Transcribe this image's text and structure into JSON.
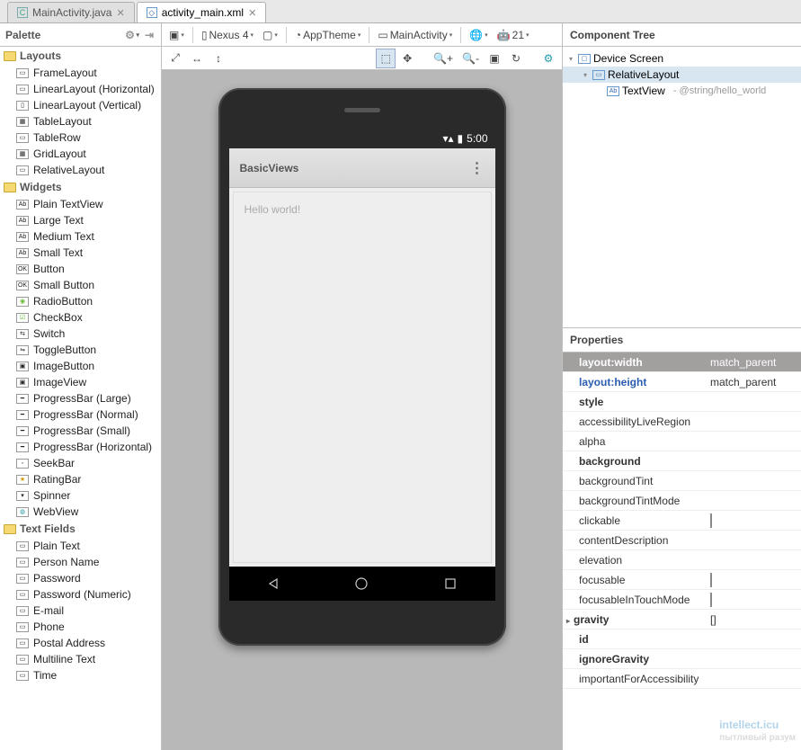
{
  "tabs": [
    {
      "label": "MainActivity.java",
      "active": false
    },
    {
      "label": "activity_main.xml",
      "active": true
    }
  ],
  "palette": {
    "title": "Palette",
    "cats": [
      {
        "name": "Layouts",
        "items": [
          "FrameLayout",
          "LinearLayout (Horizontal)",
          "LinearLayout (Vertical)",
          "TableLayout",
          "TableRow",
          "GridLayout",
          "RelativeLayout"
        ]
      },
      {
        "name": "Widgets",
        "items": [
          "Plain TextView",
          "Large Text",
          "Medium Text",
          "Small Text",
          "Button",
          "Small Button",
          "RadioButton",
          "CheckBox",
          "Switch",
          "ToggleButton",
          "ImageButton",
          "ImageView",
          "ProgressBar (Large)",
          "ProgressBar (Normal)",
          "ProgressBar (Small)",
          "ProgressBar (Horizontal)",
          "SeekBar",
          "RatingBar",
          "Spinner",
          "WebView"
        ]
      },
      {
        "name": "Text Fields",
        "items": [
          "Plain Text",
          "Person Name",
          "Password",
          "Password (Numeric)",
          "E-mail",
          "Phone",
          "Postal Address",
          "Multiline Text",
          "Time"
        ]
      }
    ]
  },
  "icons": {
    "Plain TextView": "Ab",
    "Large Text": "Ab",
    "Medium Text": "Ab",
    "Small Text": "Ab",
    "Button": "OK",
    "Small Button": "OK",
    "RadioButton": "◉",
    "CheckBox": "☑",
    "Switch": "⇆",
    "ToggleButton": "⇋",
    "ImageButton": "▣",
    "ImageView": "▣",
    "ProgressBar (Large)": "━",
    "ProgressBar (Normal)": "━",
    "ProgressBar (Small)": "━",
    "ProgressBar (Horizontal)": "━",
    "SeekBar": "◦",
    "RatingBar": "★",
    "Spinner": "▾",
    "WebView": "◍",
    "FrameLayout": "▭",
    "LinearLayout (Horizontal)": "▭",
    "LinearLayout (Vertical)": "▯",
    "TableLayout": "▦",
    "TableRow": "▭",
    "GridLayout": "▦",
    "RelativeLayout": "▭",
    "Plain Text": "▭",
    "Person Name": "▭",
    "Password": "▭",
    "Password (Numeric)": "▭",
    "E-mail": "▭",
    "Phone": "▭",
    "Postal Address": "▭",
    "Multiline Text": "▭",
    "Time": "▭"
  },
  "toolbar": {
    "device": "Nexus 4",
    "theme": "AppTheme",
    "context": "MainActivity",
    "api": "21"
  },
  "preview": {
    "status_time": "5:00",
    "app_title": "BasicViews",
    "content": "Hello world!"
  },
  "tree": {
    "title": "Component Tree",
    "nodes": [
      {
        "label": "Device Screen",
        "indent": 0,
        "arrow": "▾",
        "icon": "▢",
        "sel": false
      },
      {
        "label": "RelativeLayout",
        "indent": 1,
        "arrow": "▾",
        "icon": "▭",
        "sel": true
      },
      {
        "label": "TextView",
        "detail": "- @string/hello_world",
        "indent": 2,
        "arrow": "",
        "icon": "Ab",
        "sel": false
      }
    ]
  },
  "props": {
    "title": "Properties",
    "rows": [
      {
        "name": "layout:width",
        "val": "match_parent",
        "sel": true,
        "bold": true
      },
      {
        "name": "layout:height",
        "val": "match_parent",
        "blue": true
      },
      {
        "name": "style",
        "bold": true
      },
      {
        "name": "accessibilityLiveRegion"
      },
      {
        "name": "alpha"
      },
      {
        "name": "background",
        "bold": true
      },
      {
        "name": "backgroundTint"
      },
      {
        "name": "backgroundTintMode"
      },
      {
        "name": "clickable",
        "chk": true
      },
      {
        "name": "contentDescription"
      },
      {
        "name": "elevation"
      },
      {
        "name": "focusable",
        "chk": true
      },
      {
        "name": "focusableInTouchMode",
        "chk": true
      },
      {
        "name": "gravity",
        "val": "[]",
        "bold": true,
        "arrow": true
      },
      {
        "name": "id",
        "bold": true
      },
      {
        "name": "ignoreGravity",
        "bold": true
      },
      {
        "name": "importantForAccessibility"
      }
    ]
  },
  "watermark": {
    "main": "intellect.icu",
    "sub": "пытливый разум"
  }
}
